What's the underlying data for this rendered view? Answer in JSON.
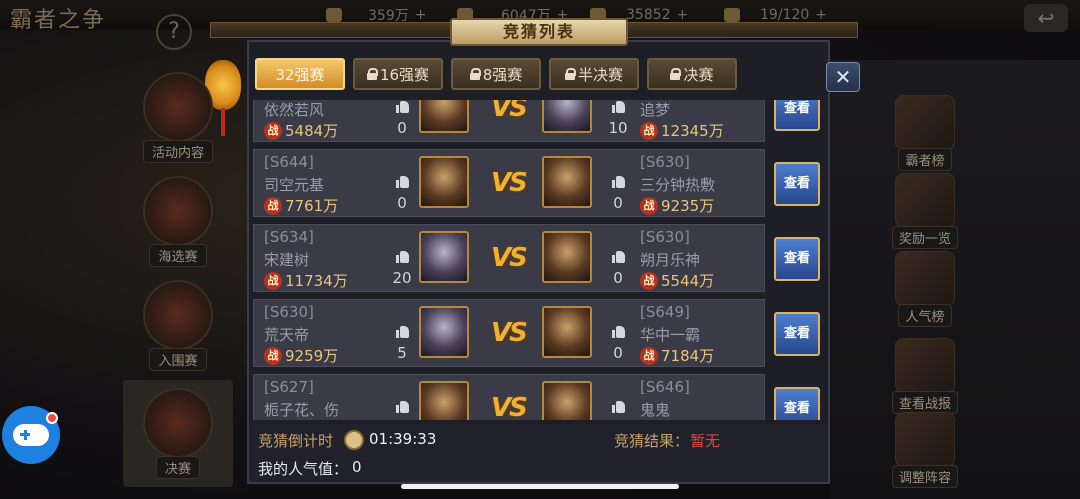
{
  "game_logo": "霸者之争",
  "resources": [
    {
      "icon": "wheat-icon",
      "value": "359万",
      "plus": "+"
    },
    {
      "icon": "treasure-icon",
      "value": "6047万",
      "plus": "+"
    },
    {
      "icon": "gold-bars-icon",
      "value": "35852",
      "plus": "+"
    },
    {
      "icon": "stamina-icon",
      "value": "19/120",
      "plus": "+"
    }
  ],
  "left_menu": [
    "活动内容",
    "海选赛",
    "入围赛",
    "决赛"
  ],
  "right_menu": [
    "霸者榜",
    "奖励一览",
    "人气榜",
    "查看战报",
    "调整阵容"
  ],
  "dialog": {
    "title": "竞猜列表",
    "tabs": [
      {
        "label": "32强赛",
        "locked": false,
        "active": true
      },
      {
        "label": "16强赛",
        "locked": true,
        "active": false
      },
      {
        "label": "8强赛",
        "locked": true,
        "active": false
      },
      {
        "label": "半决赛",
        "locked": true,
        "active": false
      },
      {
        "label": "决赛",
        "locked": true,
        "active": false
      }
    ],
    "close_label": "✕",
    "zhan_label": "战",
    "vs_label": "VS",
    "view_label": "查看",
    "matches": [
      {
        "left": {
          "server": "",
          "name": "依然若风",
          "power": "5484万",
          "likes": "0"
        },
        "right": {
          "server": "",
          "name": "追梦",
          "power": "12345万",
          "likes": "10"
        }
      },
      {
        "left": {
          "server": "[S644]",
          "name": "司空元基",
          "power": "7761万",
          "likes": "0"
        },
        "right": {
          "server": "[S630]",
          "name": "三分钟热敷",
          "power": "9235万",
          "likes": "0"
        }
      },
      {
        "left": {
          "server": "[S634]",
          "name": "宋建树",
          "power": "11734万",
          "likes": "20"
        },
        "right": {
          "server": "[S630]",
          "name": "朔月乐神",
          "power": "5544万",
          "likes": "0"
        }
      },
      {
        "left": {
          "server": "[S630]",
          "name": "荒天帝",
          "power": "9259万",
          "likes": "5"
        },
        "right": {
          "server": "[S649]",
          "name": "华中一霸",
          "power": "7184万",
          "likes": "0"
        }
      },
      {
        "left": {
          "server": "[S627]",
          "name": "栀子花、伤",
          "power": "",
          "likes": ""
        },
        "right": {
          "server": "[S646]",
          "name": "鬼鬼",
          "power": "",
          "likes": ""
        }
      }
    ],
    "countdown_label": "竞猜倒计时",
    "countdown_value": "01:39:33",
    "result_label": "竞猜结果：",
    "result_value": "暂无",
    "popularity_label": "我的人气值：",
    "popularity_value": "0"
  }
}
